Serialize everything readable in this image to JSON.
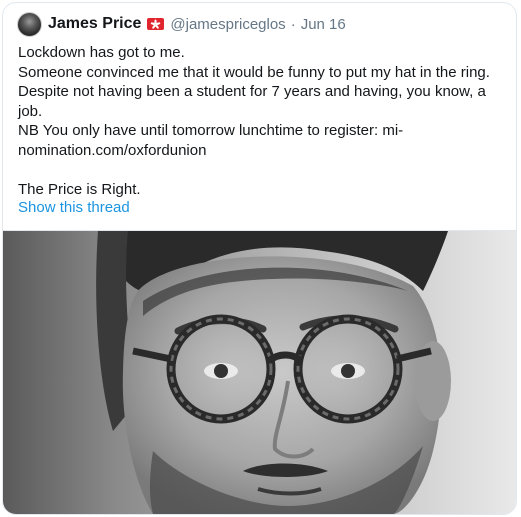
{
  "tweet": {
    "display_name": "James Price",
    "handle": "@jamespriceglos",
    "separator": "·",
    "date": "Jun 16",
    "lines": [
      "Lockdown has got to me.",
      "Someone convinced me that it would be funny to put my hat in the ring. Despite not having been a student for 7 years and having, you know, a job.",
      "NB You only have until tomorrow lunchtime to register: mi-nomination.com/oxfordunion",
      "",
      "The Price is Right."
    ],
    "show_thread": "Show this thread"
  },
  "icons": {
    "avatar": "profile-photo",
    "flag": "hong-kong-flag-icon"
  },
  "colors": {
    "name": "#14171a",
    "secondary": "#657786",
    "link": "#1b95e0",
    "border": "#e1e8ed",
    "flag_red": "#e0252f"
  }
}
